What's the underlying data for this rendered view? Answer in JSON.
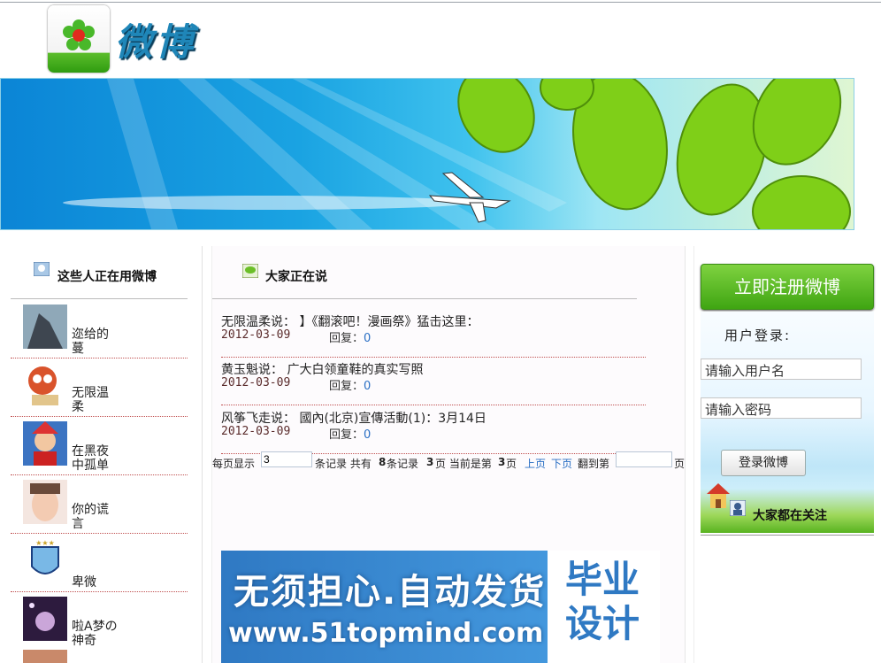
{
  "header": {
    "logo_text": "微博"
  },
  "left_panel": {
    "title": "这些人正在用微博",
    "users": [
      {
        "name": "迩给的\n蔓"
      },
      {
        "name": "无限温\n柔"
      },
      {
        "name": "在黑夜\n中孤单"
      },
      {
        "name": "你的谎\n言"
      },
      {
        "name": "卑微"
      },
      {
        "name": "啦A梦の\n神奇"
      }
    ]
  },
  "main": {
    "title": "大家正在说",
    "posts": [
      {
        "text": "无限温柔说：  】《翻滚吧！漫画祭》猛击这里：",
        "date": "2012-03-09",
        "reply_label": "回复：",
        "reply_count": "0"
      },
      {
        "text": "黄玉魁说：  广大白领童鞋的真实写照",
        "date": "2012-03-09",
        "reply_label": "回复：",
        "reply_count": "0"
      },
      {
        "text": "风筝飞走说：  國內(北京)宣傳活動(1)：3月14日",
        "date": "2012-03-09",
        "reply_label": "回复：",
        "reply_count": "0"
      }
    ],
    "pager": {
      "per_page_label": "每页显示",
      "per_page_value": "3",
      "records_label": "条记录 共有",
      "total": "8",
      "records_label2": "条记录",
      "pages": "3",
      "pages_label": "页 当前是第",
      "current": "3",
      "current_label": "页",
      "prev": "上页",
      "next": "下页",
      "goto_label": "翻到第",
      "goto_value": "",
      "goto_suffix": "页"
    },
    "ad": {
      "line1": "无须担心.自动发货",
      "line2": "www.51topmind.com",
      "side1": "毕业",
      "side2": "设计"
    }
  },
  "right_panel": {
    "register_label": "立即注册微博",
    "login_title": "用户登录:",
    "username_value": "请输入用户名",
    "password_value": "请输入密码",
    "login_button": "登录微博",
    "follow_title": "大家都在关注"
  }
}
